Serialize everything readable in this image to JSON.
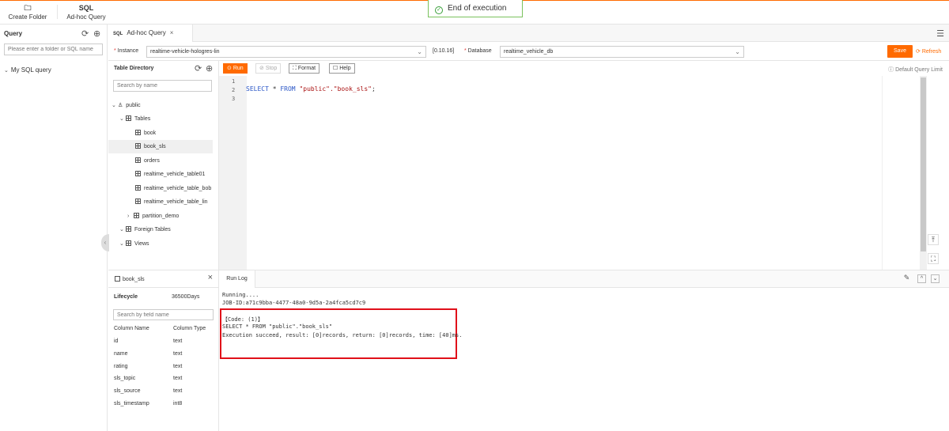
{
  "toolbar": {
    "create_folder": "Create Folder",
    "adhoc_query": "Ad-hoc Query",
    "adhoc_icon": "SQL"
  },
  "toast": {
    "message": "End of execution"
  },
  "query_panel": {
    "title": "Query",
    "search_placeholder": "Please enter a folder or SQL name",
    "tree_item": "My SQL query"
  },
  "tab": {
    "icon_text": "SQL",
    "label": "Ad-hoc Query"
  },
  "instance_row": {
    "instance_label": "Instance",
    "instance_value": "realtime-vehicle-hologres-lin",
    "version": "[0.10.16]",
    "database_label": "Database",
    "database_value": "realtime_vehicle_db",
    "save_label": "Save",
    "refresh_label": "Refresh"
  },
  "table_directory": {
    "title": "Table Directory",
    "search_placeholder": "Search by name",
    "schema": "public",
    "tables_group": "Tables",
    "tables": [
      "book",
      "book_sls",
      "orders",
      "realtime_vehicle_table01",
      "realtime_vehicle_table_bob",
      "realtime_vehicle_table_lin"
    ],
    "partition": "partition_demo",
    "foreign_tables": "Foreign Tables",
    "views": "Views"
  },
  "editor_toolbar": {
    "run": "Run",
    "stop": "Stop",
    "format": "Format",
    "help": "Help",
    "default_query_limit": "Default Query Limit"
  },
  "editor": {
    "line_numbers": [
      "1",
      "2",
      "3"
    ],
    "code_keyword_select": "SELECT",
    "code_star": " * ",
    "code_keyword_from": "FROM",
    "code_string": "\"public\".\"book_sls\"",
    "code_end": ";"
  },
  "table_detail": {
    "name": "book_sls",
    "lifecycle_label": "Lifecycle",
    "lifecycle_value": "36500Days",
    "field_search_placeholder": "Search by field name",
    "col_header_name": "Column Name",
    "col_header_type": "Column Type",
    "columns": [
      {
        "name": "id",
        "type": "text"
      },
      {
        "name": "name",
        "type": "text"
      },
      {
        "name": "rating",
        "type": "text"
      },
      {
        "name": "sls_topic",
        "type": "text"
      },
      {
        "name": "sls_source",
        "type": "text"
      },
      {
        "name": "sls_timestamp",
        "type": "int8"
      }
    ]
  },
  "run_log": {
    "tab": "Run Log",
    "lines": [
      "Running....",
      "JOB-ID:a71c9bba-4477-48a0-9d5a-2a4fca5cd7c9",
      "【Code: (1)】",
      "SELECT * FROM \"public\".\"book_sls\"",
      "Execution succeed, result: [0]records, return: [0]records, time: [40]ms."
    ]
  },
  "colors": {
    "accent": "#ff6a00",
    "highlight_box": "#e0101a",
    "success": "#3aa03a"
  }
}
